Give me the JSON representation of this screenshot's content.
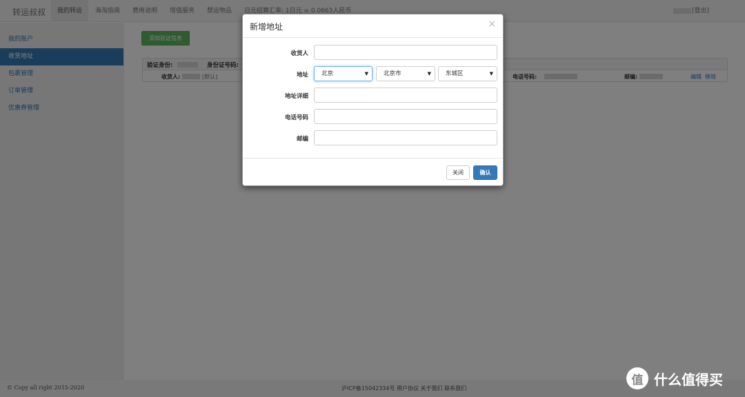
{
  "navbar": {
    "brand": "转运叔叔",
    "items": [
      "我的转运",
      "海淘指南",
      "费用说明",
      "增值服务",
      "禁运物品"
    ],
    "rate_text": "日元结算汇率: 1日元 = 0.0663人民币",
    "logout": "[登出]"
  },
  "sidebar": {
    "items": [
      "我的账户",
      "收货地址",
      "包裹管理",
      "订单管理",
      "优惠券管理"
    ],
    "active": "收货地址"
  },
  "content": {
    "add_button": "添加验证信息",
    "address_card": {
      "id_label": "验证身份:",
      "id_number_label": "身份证号码:",
      "receiver_label": "收货人:",
      "default_tag": "[默认]",
      "phone_label": "电话号码:",
      "postcode_label": "邮编:",
      "edit": "编辑",
      "remove": "移除"
    }
  },
  "modal": {
    "title": "新增地址",
    "close_icon": "×",
    "fields": {
      "receiver": "收货人",
      "address": "地址",
      "address_detail": "地址详细",
      "phone": "电话号码",
      "postcode": "邮编"
    },
    "selects": {
      "province": "北京",
      "city": "北京市",
      "district": "东城区"
    },
    "buttons": {
      "close": "关闭",
      "confirm": "确认"
    }
  },
  "footer": {
    "copyright": "© Copy all right 2015-2020",
    "links": "沪ICP备15042334号  用户协议  关于我们  联系我们"
  },
  "watermark": {
    "circle": "值",
    "text": "什么值得买"
  },
  "colors": {
    "primary": "#337ab7",
    "success": "#5cb85c",
    "overlay": "rgba(0,0,0,0.5)"
  }
}
